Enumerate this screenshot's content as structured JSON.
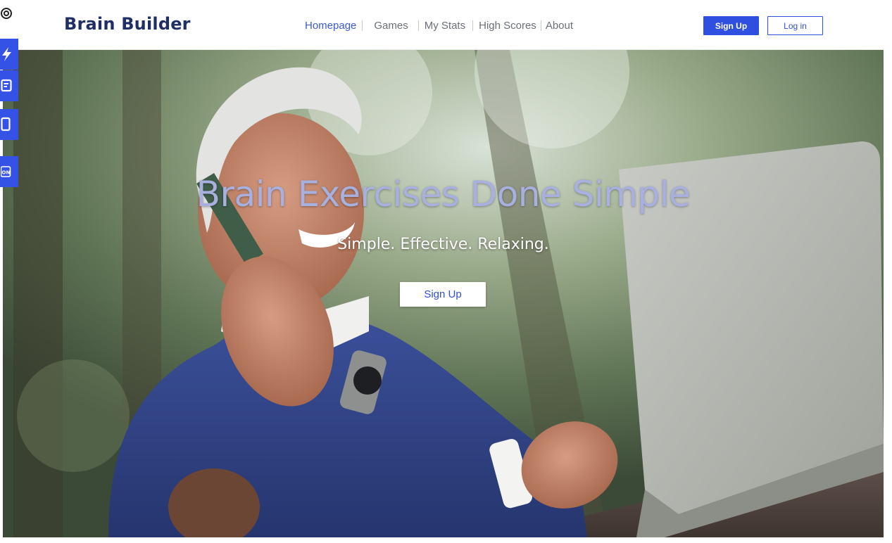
{
  "header": {
    "brand": "Brain Builder",
    "nav": [
      {
        "label": "Homepage",
        "active": true
      },
      {
        "label": "Games",
        "active": false
      },
      {
        "label": "My Stats",
        "active": false
      },
      {
        "label": "High Scores",
        "active": false
      },
      {
        "label": "About",
        "active": false
      }
    ],
    "signup_label": "Sign Up",
    "login_label": "Log in"
  },
  "hero": {
    "title": "Brain Exercises Done Simple",
    "subtitle": "Simple. Effective. Relaxing.",
    "cta_label": "Sign Up",
    "image": "photo-older-man-on-phone-with-laptop-outdoors"
  },
  "side_tools": [
    {
      "icon": "target-icon"
    },
    {
      "icon": "lightning-icon"
    },
    {
      "icon": "document-icon"
    },
    {
      "icon": "tablet-icon"
    },
    {
      "icon": "json-icon",
      "text": "ON"
    }
  ],
  "colors": {
    "brand": "#1f2f66",
    "accent": "#2f4fe0",
    "active_nav": "#3a5bd9",
    "hero_title": "#a7b0df"
  }
}
